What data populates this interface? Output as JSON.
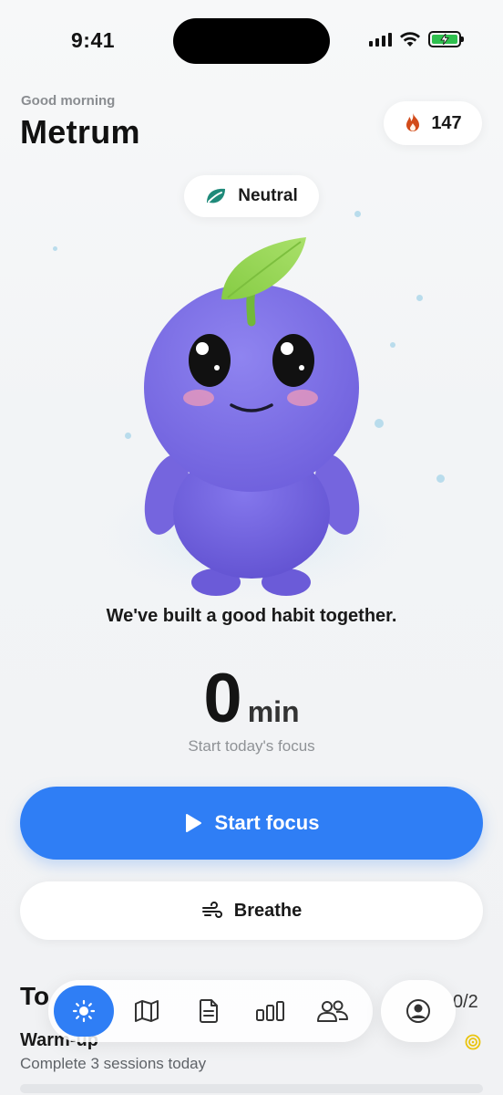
{
  "status_bar": {
    "time": "9:41"
  },
  "header": {
    "greeting": "Good morning",
    "username": "Metrum",
    "streak_count": "147"
  },
  "mood": {
    "label": "Neutral"
  },
  "companion": {
    "message": "We've built a good habit together."
  },
  "focus": {
    "value": "0",
    "unit": "min",
    "subtitle": "Start today's focus"
  },
  "actions": {
    "start_label": "Start focus",
    "breathe_label": "Breathe"
  },
  "missions": {
    "title_visible": "To",
    "count": "0/2",
    "first": {
      "title": "Warm-up",
      "subtitle": "Complete 3 sessions today",
      "progress": 0
    }
  },
  "tabs": [
    {
      "name": "today",
      "icon": "sun-icon",
      "active": true
    },
    {
      "name": "map",
      "icon": "map-icon",
      "active": false
    },
    {
      "name": "notes",
      "icon": "document-icon",
      "active": false
    },
    {
      "name": "stats",
      "icon": "bar-chart-icon",
      "active": false
    },
    {
      "name": "friends",
      "icon": "people-icon",
      "active": false
    }
  ],
  "profile_icon": "profile-icon",
  "colors": {
    "accent": "#2f7ef5",
    "mascot": "#7f71e6",
    "leaf": "#8fd14f",
    "streak_flame": "#d24b1a",
    "mood_leaf": "#1f8a7a"
  }
}
